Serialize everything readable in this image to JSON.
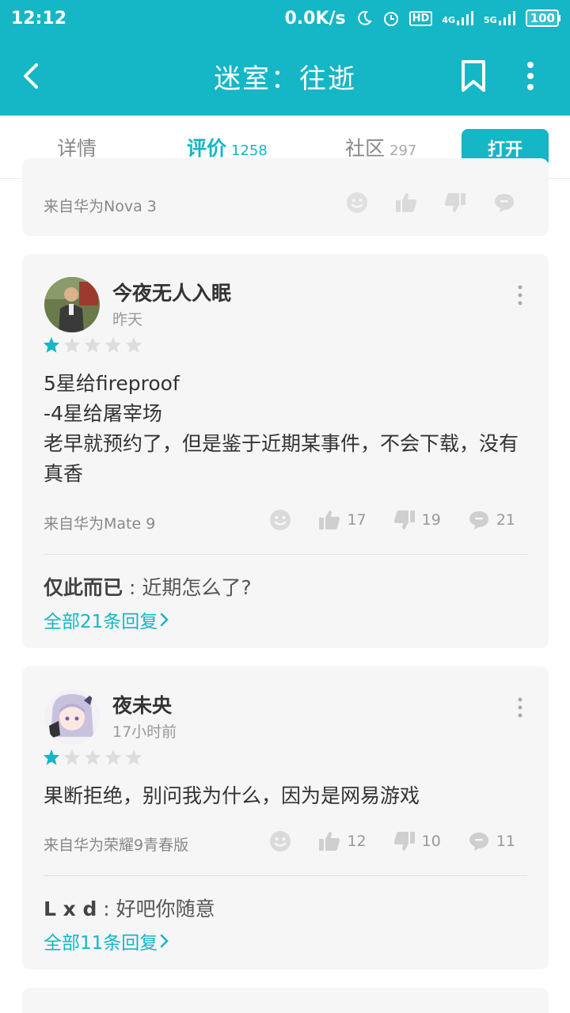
{
  "status_bar": {
    "time": "12:12",
    "speed": "0.0K/s",
    "hd": "HD",
    "net1": "4G",
    "net2": "5G",
    "battery": "100"
  },
  "app_bar": {
    "title": "迷室：往逝"
  },
  "tabs": [
    {
      "label": "详情",
      "count": ""
    },
    {
      "label": "评价",
      "count": "1258"
    },
    {
      "label": "社区",
      "count": "297"
    }
  ],
  "open_button": "打开",
  "prev_card": {
    "device": "来自华为Nova 3"
  },
  "reviews": [
    {
      "user": "今夜无人入眠",
      "time": "昨天",
      "rating": 1,
      "text": "5星给fireproof\n-4星给屠宰场\n老早就预约了，但是鉴于近期某事件，不会下载，没有真香",
      "device": "来自华为Mate 9",
      "likes": "17",
      "dislikes": "19",
      "comments": "21",
      "reply_user": "仅此而已",
      "reply_text": " : 近期怎么了?",
      "all_replies": "全部21条回复"
    },
    {
      "user": "夜未央",
      "time": "17小时前",
      "rating": 1,
      "text": "果断拒绝，别问我为什么，因为是网易游戏",
      "device": "来自华为荣耀9青春版",
      "likes": "12",
      "dislikes": "10",
      "comments": "11",
      "reply_user": "L x d",
      "reply_text": " : 好吧你随意",
      "all_replies": "全部11条回复"
    }
  ],
  "colors": {
    "accent": "#15b6c6",
    "card_bg": "#f6f6f6",
    "star_off": "#dddddd"
  },
  "icons": [
    "back-icon",
    "bookmark-icon",
    "more-icon",
    "emoji-icon",
    "thumbs-up-icon",
    "thumbs-down-icon",
    "comment-icon",
    "star-icon",
    "chevron-right-icon"
  ]
}
